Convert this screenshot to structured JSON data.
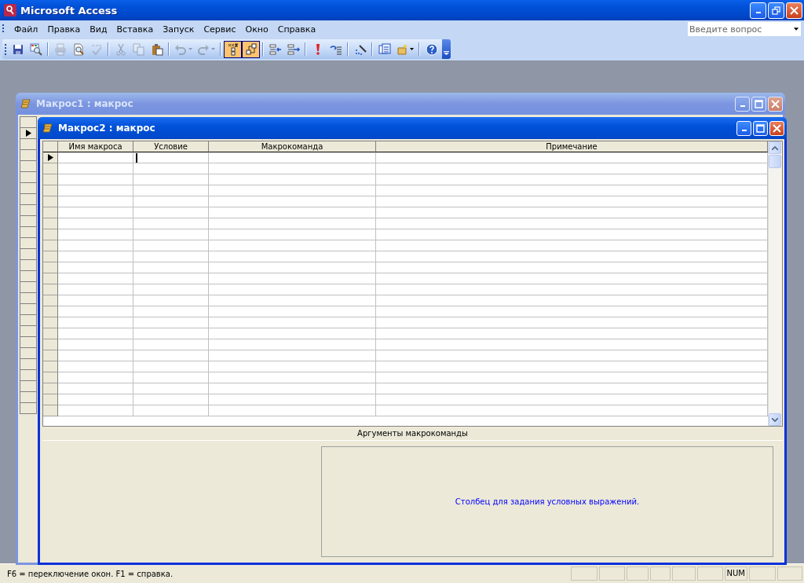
{
  "app_window": {
    "title": "Microsoft Access"
  },
  "menu": [
    {
      "label": "Файл"
    },
    {
      "label": "Правка"
    },
    {
      "label": "Вид"
    },
    {
      "label": "Вставка"
    },
    {
      "label": "Запуск"
    },
    {
      "label": "Сервис"
    },
    {
      "label": "Окно"
    },
    {
      "label": "Справка"
    }
  ],
  "help_field": {
    "placeholder": "Введите вопрос"
  },
  "toolbar": [
    {
      "kind": "button",
      "disabled": false,
      "pressed": false
    },
    {
      "kind": "button",
      "disabled": false,
      "pressed": false
    },
    {
      "kind": "separator"
    },
    {
      "kind": "button",
      "disabled": true,
      "pressed": false
    },
    {
      "kind": "button",
      "disabled": false,
      "pressed": false
    },
    {
      "kind": "button",
      "disabled": true,
      "pressed": false
    },
    {
      "kind": "separator"
    },
    {
      "kind": "button",
      "disabled": true,
      "pressed": false
    },
    {
      "kind": "button",
      "disabled": true,
      "pressed": false
    },
    {
      "kind": "button",
      "disabled": false,
      "pressed": false
    },
    {
      "kind": "separator"
    },
    {
      "kind": "button",
      "disabled": true,
      "pressed": false,
      "dropdown": true
    },
    {
      "kind": "button",
      "disabled": true,
      "pressed": false,
      "dropdown": true
    },
    {
      "kind": "separator"
    },
    {
      "kind": "button",
      "disabled": false,
      "pressed": true
    },
    {
      "kind": "button",
      "disabled": false,
      "pressed": true
    },
    {
      "kind": "separator"
    },
    {
      "kind": "button",
      "disabled": false,
      "pressed": false
    },
    {
      "kind": "button",
      "disabled": false,
      "pressed": false
    },
    {
      "kind": "separator"
    },
    {
      "kind": "button",
      "disabled": false,
      "pressed": false
    },
    {
      "kind": "button",
      "disabled": false,
      "pressed": false
    },
    {
      "kind": "separator"
    },
    {
      "kind": "button",
      "disabled": false,
      "pressed": false
    },
    {
      "kind": "separator"
    },
    {
      "kind": "button",
      "disabled": false,
      "pressed": false
    },
    {
      "kind": "button",
      "disabled": false,
      "pressed": false,
      "dropdown": true
    },
    {
      "kind": "separator"
    },
    {
      "kind": "button",
      "disabled": false,
      "pressed": false
    }
  ],
  "windows": [
    {
      "title": "Макрос1 : макрос",
      "active": false
    },
    {
      "title": "Макрос2 : макрос",
      "active": true,
      "columns": [
        {
          "label": "Имя макроса"
        },
        {
          "label": "Условие"
        },
        {
          "label": "Макрокоманда"
        },
        {
          "label": "Примечание"
        }
      ],
      "arguments_title": "Аргументы макрокоманды",
      "hint": "Столбец для задания условных выражений."
    }
  ],
  "status_bar": {
    "text": "F6 = переключение окон.  F1 = справка.",
    "indicators": [
      {
        "label": "NUM"
      }
    ]
  }
}
